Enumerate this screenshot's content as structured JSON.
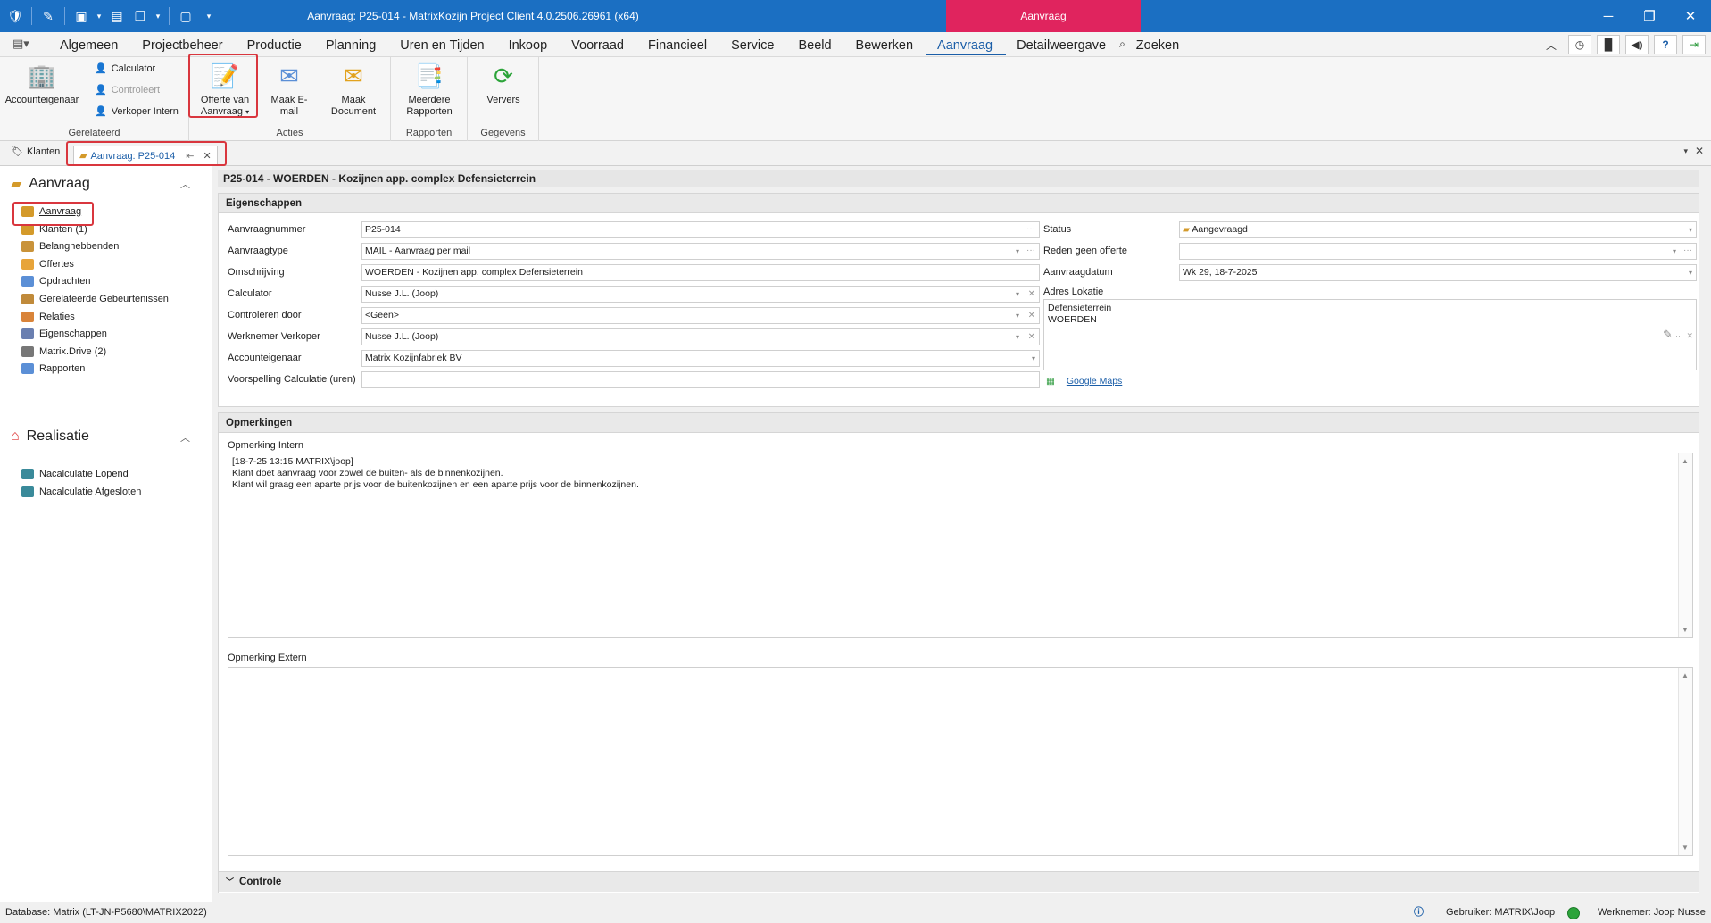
{
  "window": {
    "title": "Aanvraag: P25-014 - MatrixKozijn Project Client 4.0.2506.26961 (x64)",
    "context_tab": "Aanvraag"
  },
  "menu": {
    "tabs": [
      "Algemeen",
      "Projectbeheer",
      "Productie",
      "Planning",
      "Uren en Tijden",
      "Inkoop",
      "Voorraad",
      "Financieel",
      "Service",
      "Beeld",
      "Bewerken",
      "Aanvraag",
      "Detailweergave",
      "Zoeken"
    ],
    "active": "Aanvraag"
  },
  "ribbon": {
    "accounteigenaar": "Accounteigenaar",
    "calculator": "Calculator",
    "controleert": "Controleert",
    "verkoper_intern": "Verkoper Intern",
    "group_gerelateerd": "Gerelateerd",
    "offerte_line1": "Offerte van",
    "offerte_line2": "Aanvraag",
    "maak_email": "Maak E-mail",
    "maak_document": "Maak Document",
    "group_acties": "Acties",
    "meerdere_line1": "Meerdere",
    "meerdere_line2": "Rapporten",
    "group_rapporten": "Rapporten",
    "ververs": "Ververs",
    "group_gegevens": "Gegevens"
  },
  "doctabs": {
    "klanten": "Klanten",
    "aanvraag": "Aanvraag: P25-014"
  },
  "sidebar": {
    "section1": "Aanvraag",
    "items1": [
      "Aanvraag",
      "Klanten (1)",
      "Belanghebbenden",
      "Offertes",
      "Opdrachten",
      "Gerelateerde Gebeurtenissen",
      "Relaties",
      "Eigenschappen",
      "Matrix.Drive (2)",
      "Rapporten"
    ],
    "section2": "Realisatie",
    "items2": [
      "Nacalculatie Lopend",
      "Nacalculatie Afgesloten"
    ]
  },
  "main": {
    "title": "P25-014 - WOERDEN - Kozijnen app. complex Defensieterrein",
    "eigenschappen": "Eigenschappen",
    "labels": {
      "aanvraagnummer": "Aanvraagnummer",
      "aanvraagtype": "Aanvraagtype",
      "omschrijving": "Omschrijving",
      "calculator": "Calculator",
      "controleren_door": "Controleren door",
      "werknemer_verkoper": "Werknemer Verkoper",
      "accounteigenaar": "Accounteigenaar",
      "voorspelling": "Voorspelling Calculatie (uren)",
      "status": "Status",
      "reden": "Reden geen offerte",
      "aanvraagdatum": "Aanvraagdatum",
      "adres": "Adres Lokatie"
    },
    "values": {
      "aanvraagnummer": "P25-014",
      "aanvraagtype": "MAIL - Aanvraag per mail",
      "omschrijving": "WOERDEN - Kozijnen app. complex Defensieterrein",
      "calculator": "Nusse J.L. (Joop)",
      "controleren_door": "<Geen>",
      "werknemer_verkoper": "Nusse J.L. (Joop)",
      "accounteigenaar": "Matrix Kozijnfabriek BV",
      "voorspelling": "",
      "status": "Aangevraagd",
      "reden": "",
      "aanvraagdatum": "Wk 29, 18-7-2025",
      "adres": "Defensieterrein\nWOERDEN",
      "google_maps": "Google Maps"
    },
    "opmerkingen": "Opmerkingen",
    "opmerking_intern_label": "Opmerking Intern",
    "opmerking_intern": "[18-7-25 13:15 MATRIX\\joop]\nKlant doet aanvraag voor zowel de buiten- als de binnenkozijnen.\nKlant wil graag een aparte prijs voor de buitenkozijnen en een aparte prijs voor de binnenkozijnen.",
    "opmerking_extern_label": "Opmerking Extern",
    "opmerking_extern": "",
    "controle": "Controle"
  },
  "status": {
    "database": "Database: Matrix (LT-JN-P5680\\MATRIX2022)",
    "gebruiker": "Gebruiker: MATRIX\\Joop",
    "werknemer": "Werknemer: Joop Nusse"
  }
}
